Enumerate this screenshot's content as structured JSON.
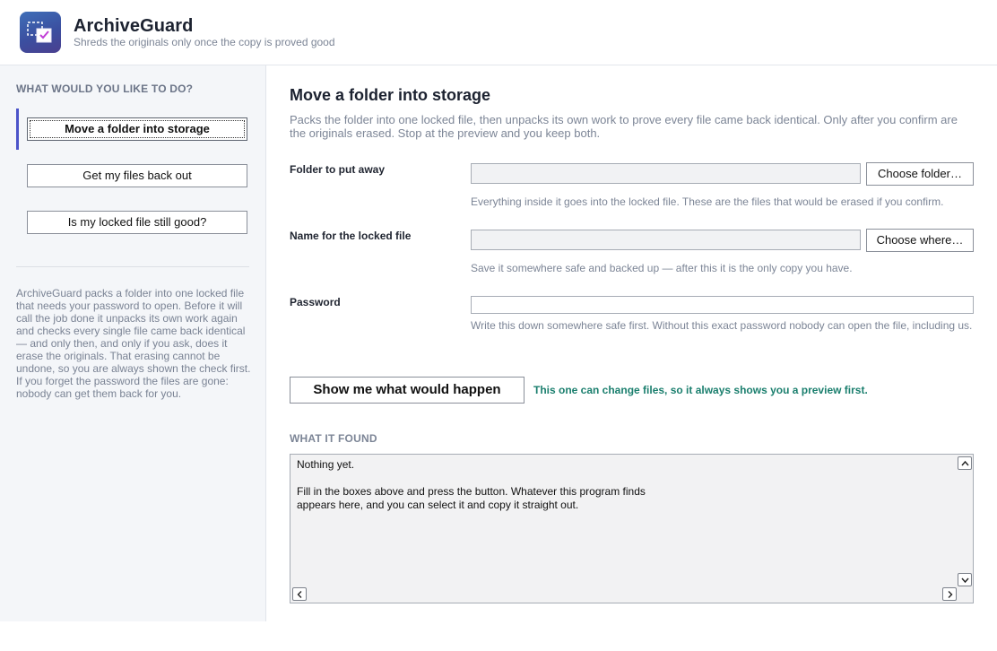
{
  "app": {
    "title": "ArchiveGuard",
    "subtitle": "Shreds the originals only once the copy is proved good"
  },
  "sidebar": {
    "heading": "WHAT WOULD YOU LIKE TO DO?",
    "items": [
      {
        "label": "Move a folder into storage",
        "active": true
      },
      {
        "label": "Get my files back out",
        "active": false
      },
      {
        "label": "Is my locked file still good?",
        "active": false
      }
    ],
    "description": "ArchiveGuard packs a folder into one locked file that needs your password to open. Before it will call the job done it unpacks its own work again and checks every single file came back identical — and only then, and only if you ask, does it erase the originals. That erasing cannot be undone, so you are always shown the check first. If you forget the password the files are gone: nobody can get them back for you."
  },
  "main": {
    "title": "Move a folder into storage",
    "description": "Packs the folder into one locked file, then unpacks its own work to prove every file came back identical. Only after you confirm are the originals erased. Stop at the preview and you keep both.",
    "fields": {
      "folder": {
        "label": "Folder to put away",
        "value": "",
        "button": "Choose folder…",
        "help": "Everything inside it goes into the locked file. These are the files that would be erased if you confirm."
      },
      "locked_file": {
        "label": "Name for the locked file",
        "value": "",
        "button": "Choose where…",
        "help": "Save it somewhere safe and backed up — after this it is the only copy you have."
      },
      "password": {
        "label": "Password",
        "value": "",
        "help": "Write this down somewhere safe first. Without this exact password nobody can open the file, including us."
      }
    },
    "action_button": "Show me what would happen",
    "preview_note": "This one can change files, so it always shows you a preview first.",
    "output": {
      "heading": "WHAT IT FOUND",
      "text": "Nothing yet.\n\nFill in the boxes above and press the button. Whatever this program finds\nappears here, and you can select it and copy it straight out."
    }
  },
  "colors": {
    "accent": "#4b53c9",
    "note_green": "#1b7f6e",
    "sidebar_bg": "#f4f6f9"
  }
}
